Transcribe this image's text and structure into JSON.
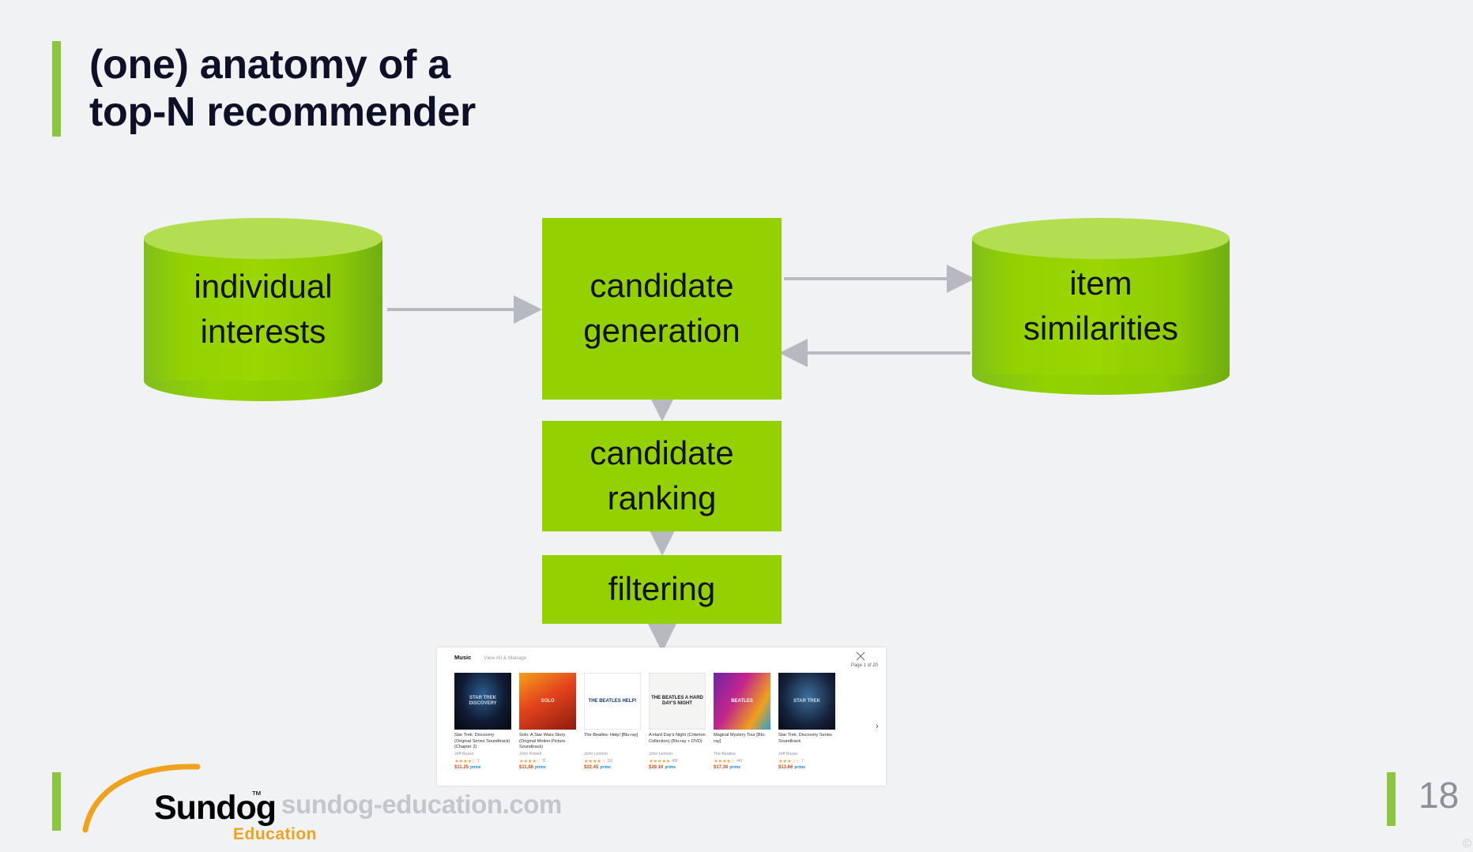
{
  "slide": {
    "title": "(one) anatomy of a\ntop-N recommender",
    "page_number": "18",
    "corner_mark": "©",
    "accent_color": "#8cc63e",
    "box_color": "#93d200",
    "cylinder_top_color": "#b4de52",
    "background_color": "#f1f2f4"
  },
  "diagram": {
    "nodes": [
      {
        "id": "individual-interests",
        "label": "individual\ninterests",
        "shape": "cylinder"
      },
      {
        "id": "candidate-generation",
        "label": "candidate\ngeneration",
        "shape": "box"
      },
      {
        "id": "item-similarities",
        "label": "item\nsimilarities",
        "shape": "cylinder"
      },
      {
        "id": "candidate-ranking",
        "label": "candidate\nranking",
        "shape": "box"
      },
      {
        "id": "filtering",
        "label": "filtering",
        "shape": "box"
      }
    ]
  },
  "widget": {
    "category": "Music",
    "view_all": "View All & Manage",
    "page_indicator": "Page 1 of 20",
    "next_arrow": "›",
    "close_icon": "×",
    "products": [
      {
        "cover_text": "STAR TREK DISCOVERY",
        "title": "Star Trek: Discovery (Original Series Soundtrack) (Chapter 2)",
        "artist": "Jeff Russo",
        "stars": "★★★★☆",
        "rating_count": "1",
        "price": "$11.25",
        "prime": "prime"
      },
      {
        "cover_text": "SOLO",
        "title": "Solo: A Star Wars Story (Original Motion Picture Soundtrack)",
        "artist": "John Powell",
        "stars": "★★★★☆",
        "rating_count": "11",
        "price": "$11.88",
        "prime": "prime"
      },
      {
        "cover_text": "THE BEATLES HELP!",
        "title": "The Beatles: Help! [Blu-ray]",
        "artist": "John Lennon",
        "stars": "★★★★☆",
        "rating_count": "116",
        "price": "$22.45",
        "prime": "prime"
      },
      {
        "cover_text": "THE BEATLES A HARD DAY'S NIGHT",
        "title": "A Hard Day's Night (Criterion Collection) (Blu-ray + DVD)",
        "artist": "John Lennon",
        "stars": "★★★★★",
        "rating_count": "456",
        "price": "$29.10",
        "prime": "prime"
      },
      {
        "cover_text": "BEATLES",
        "title": "Magical Mystery Tour [Blu-ray]",
        "artist": "The Beatles",
        "stars": "★★★★☆",
        "rating_count": "441",
        "price": "$17.36",
        "prime": "prime"
      },
      {
        "cover_text": "STAR TREK",
        "title": "Star Trek: Discovery Series Soundtrack",
        "artist": "Jeff Russo",
        "stars": "★★★☆☆",
        "rating_count": "7",
        "price": "$13.66",
        "prime": "prime"
      }
    ]
  },
  "footer": {
    "logo_word": "Sundog",
    "logo_tm": "™",
    "logo_sub": "Education",
    "site_url": "sundog-education.com"
  }
}
